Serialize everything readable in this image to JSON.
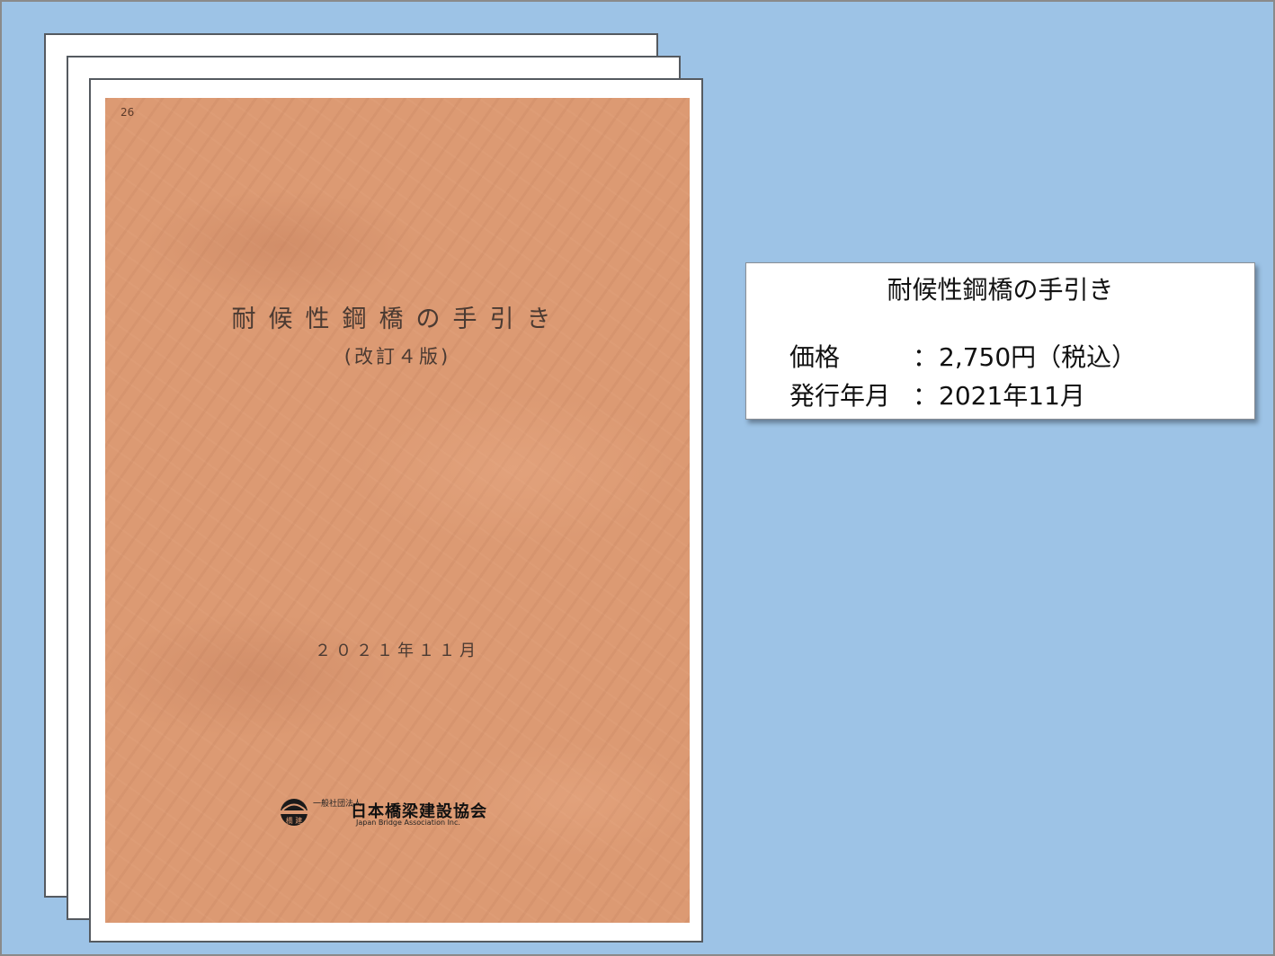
{
  "cover": {
    "page_number": "26",
    "title": "耐候性鋼橋の手引き",
    "edition": "(改訂４版)",
    "date": "２０２１年１１月",
    "publisher": {
      "legal_form": "一般社団法人",
      "name": "日本橋梁建設協会",
      "name_en": "Japan Bridge Association Inc.",
      "logo_text": "橋建"
    }
  },
  "info": {
    "title": "耐候性鋼橋の手引き",
    "rows": [
      {
        "label": "価格",
        "colon": "：",
        "value": "2,750円（税込）"
      },
      {
        "label": "発行年月",
        "colon": "：",
        "value": "2021年11月"
      }
    ]
  }
}
